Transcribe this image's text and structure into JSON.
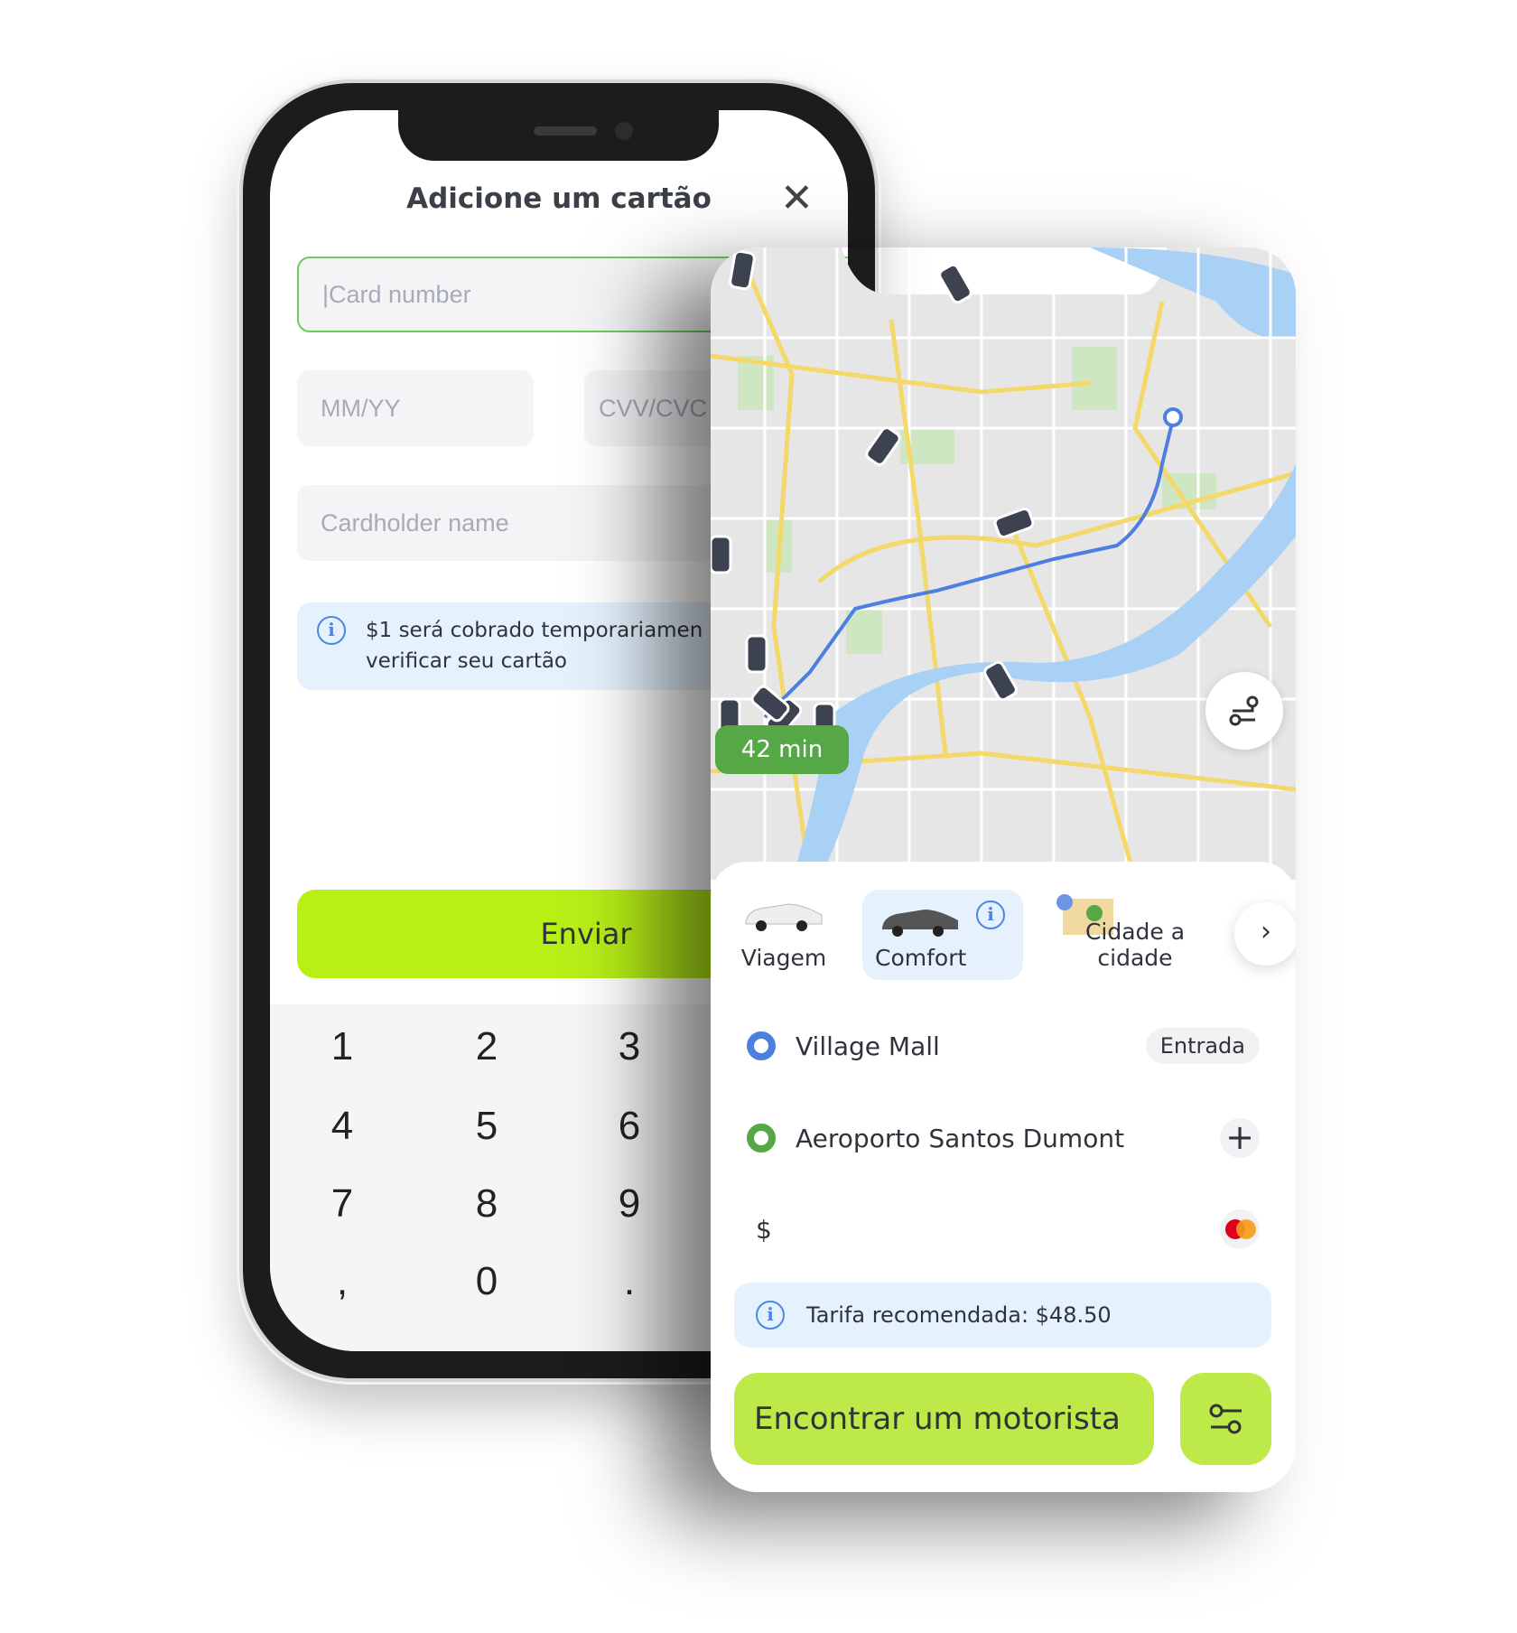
{
  "card_form": {
    "title": "Adicione um cartão",
    "card_number_placeholder": "|Card number",
    "expiry_placeholder": "MM/YY",
    "cvv_placeholder": "CVV/CVC",
    "cardholder_placeholder": "Cardholder name",
    "info_line1": "$1 será cobrado temporariamen",
    "info_line2": "verificar seu cartão",
    "submit_label": "Enviar",
    "keypad": [
      "1",
      "2",
      "3",
      "4",
      "5",
      "6",
      "7",
      "8",
      "9",
      ",",
      "0",
      "."
    ]
  },
  "ride": {
    "eta_badge": "42 min",
    "tabs": [
      {
        "label": "Viagem"
      },
      {
        "label": "Comfort",
        "selected": true
      },
      {
        "label": "Cidade a cidade"
      }
    ],
    "pickup": "Village Mall",
    "pickup_action": "Entrada",
    "destination": "Aeroporto Santos Dumont",
    "price_symbol": "$",
    "recommended_fare": "Tarifa recomendada: $48.50",
    "find_driver_label": "Encontrar um motorista",
    "colors": {
      "accent": "#bdea48",
      "pickup": "#4c7fe0",
      "destination": "#55a845",
      "info_bg": "#e5f2fd"
    }
  }
}
